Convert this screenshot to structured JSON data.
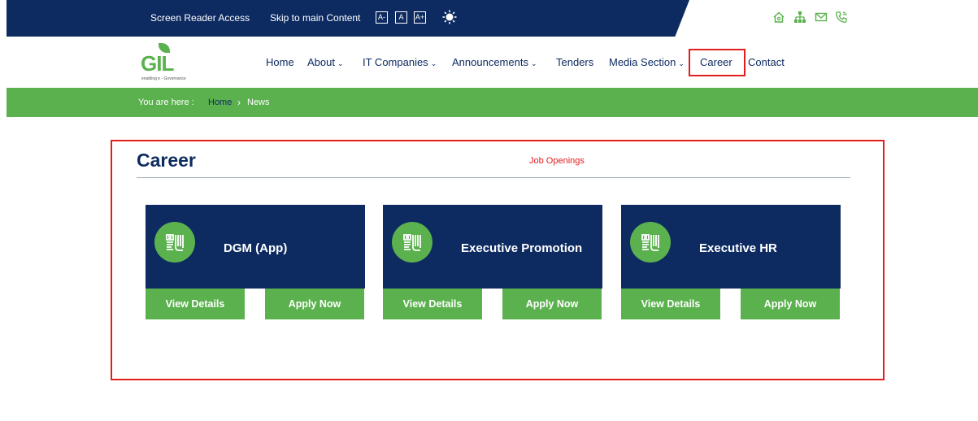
{
  "topbar": {
    "screen_reader": "Screen Reader Access",
    "skip_content": "Skip to main Content",
    "font_small": "A-",
    "font_normal": "A",
    "font_large": "A+"
  },
  "nav": {
    "items": [
      {
        "label": "Home",
        "dropdown": false
      },
      {
        "label": "About",
        "dropdown": true
      },
      {
        "label": "IT Companies",
        "dropdown": true
      },
      {
        "label": "Announcements",
        "dropdown": true
      },
      {
        "label": "Tenders",
        "dropdown": false
      },
      {
        "label": "Media Section",
        "dropdown": true
      },
      {
        "label": "Career",
        "dropdown": false
      },
      {
        "label": "Contact",
        "dropdown": false
      }
    ],
    "chevron": "⌄"
  },
  "logo": {
    "text": "GIL",
    "tagline": "enabling e - Governance"
  },
  "breadcrumb": {
    "label": "You are here :",
    "home": "Home",
    "separator": "›",
    "current": "News"
  },
  "main": {
    "title": "Career",
    "subtitle": "Job Openings",
    "jobs": [
      {
        "title": "DGM (App)",
        "details_label": "View Details",
        "apply_label": "Apply Now"
      },
      {
        "title": "Executive Promotion",
        "details_label": "View Details",
        "apply_label": "Apply Now"
      },
      {
        "title": "Executive HR",
        "details_label": "View Details",
        "apply_label": "Apply Now"
      }
    ]
  },
  "colors": {
    "navy": "#0d2b61",
    "green": "#5bb14e",
    "highlight_red": "#e11d1d"
  },
  "icons": [
    "contrast-icon",
    "home-icon",
    "sitemap-icon",
    "mail-icon",
    "phone-icon",
    "document-icon"
  ]
}
